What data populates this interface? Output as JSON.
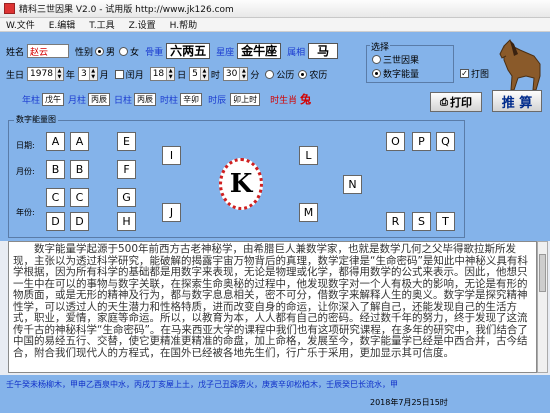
{
  "window": {
    "title": "精科三世因果 V2.0 - 试用版 http://www.jk126.com"
  },
  "menu": [
    "W.文件",
    "E.编辑",
    "T.工具",
    "Z.设置",
    "H.帮助"
  ],
  "form": {
    "name_label": "姓名",
    "name_value": "赵云",
    "gender_label": "性别",
    "gender_male": "男",
    "gender_female": "女",
    "gender_selected": "male",
    "zodiac_label": "骨重",
    "zodiac_value": "六两五",
    "star_label": "星座",
    "star_value": "金牛座",
    "animal_label": "属相",
    "animal_value": "马",
    "birth_label": "生日",
    "year_value": "1978",
    "year_label": "年",
    "month_value": "3",
    "month_label": "月",
    "leap_label": "闰月",
    "day_value": "18",
    "day_label": "日",
    "hour_value": "5",
    "hour_label": "时",
    "minute_value": "30",
    "minute_label": "分",
    "calendar_gregorian": "公历",
    "calendar_lunar": "农历",
    "calendar_selected": "lunar"
  },
  "pillars": {
    "year_label": "年柱",
    "year_value": "戊午",
    "month_label": "月柱",
    "month_value": "丙辰",
    "day_label": "日柱",
    "day_value": "丙辰",
    "hour_label": "时柱",
    "hour_value": "辛卯",
    "time_label": "时辰",
    "time_value": "卯上时",
    "zodiac_hour_label": "时生肖",
    "zodiac_hour_value": "兔"
  },
  "choice": {
    "title": "选择",
    "opt1": "三世因果",
    "opt2": "数字能量",
    "selected": "opt2",
    "print_check_label": "打图",
    "print_checked": true
  },
  "buttons": {
    "print": "打印",
    "calc": "推 算"
  },
  "energy_group": {
    "title": "数字能量图",
    "row_day": "日期:",
    "row_month": "月份:",
    "row_year": "年份:",
    "letters": [
      "A",
      "A",
      "E",
      "B",
      "B",
      "F",
      "C",
      "C",
      "G",
      "D",
      "D",
      "H",
      "I",
      "J",
      "L",
      "M",
      "N",
      "O",
      "P",
      "Q",
      "R",
      "S",
      "T"
    ],
    "center_letter": "K"
  },
  "description": "数字能量学起源于500年前西方古老神秘学，由希腊巨人兼数学家，也就是数学几何之父毕得歌拉斯所发现，主张以为透过科学研究，能破解的揭露宇宙万物背后的真理，数学定律是“生命密码”是知此中神秘义具有科学根据，因为所有科学的基础都是用数字来表现，无论是物理或化学，都得用数学的公式来表示。因此，他想只一生中在可以的事物与数字关联，在探索生命奥秘的过程中，他发现数字对一个人有极大的影响，无论是有形的物质面，或是无形的精神及行为，都与数字息息相关，密不可分，借数字来解释人生的奥义。数字学是探究精神性学，可以透过人的天生潜力和性格特质，进而改变自身的命运，让你深入了解自己，还能发现自己的生活方式，职业，爱情，家庭等命运。所以，以教育为本，人人都有自己的密码。经过数千年的努力，终于发现了这流传千古的神秘科学“生命密码”。在马来西亚大学的课程中我们也有这项研究课程，在多年的研究中，我们结合了中国的易经五行、交替，使它更精准更精准的命盘，加上命格，发展至今，数字能量学已经是中西合并，古今结合，附合我们现代人的方程式，在国外已经被各地先生们，行广乐于采用，更加显示其可信度。",
  "status": {
    "ticker": "壬午癸未杨柳木，甲申乙酉泉中水，丙戌丁亥屋上土，戊子己丑霹雳火，庚寅辛卯松柏木，壬辰癸巳长流水，甲",
    "datetime": "2018年7月25日15时"
  },
  "colors": {
    "panel": "#84b3ea",
    "accent_red": "#d40000",
    "accent_blue": "#1b3bd0"
  }
}
